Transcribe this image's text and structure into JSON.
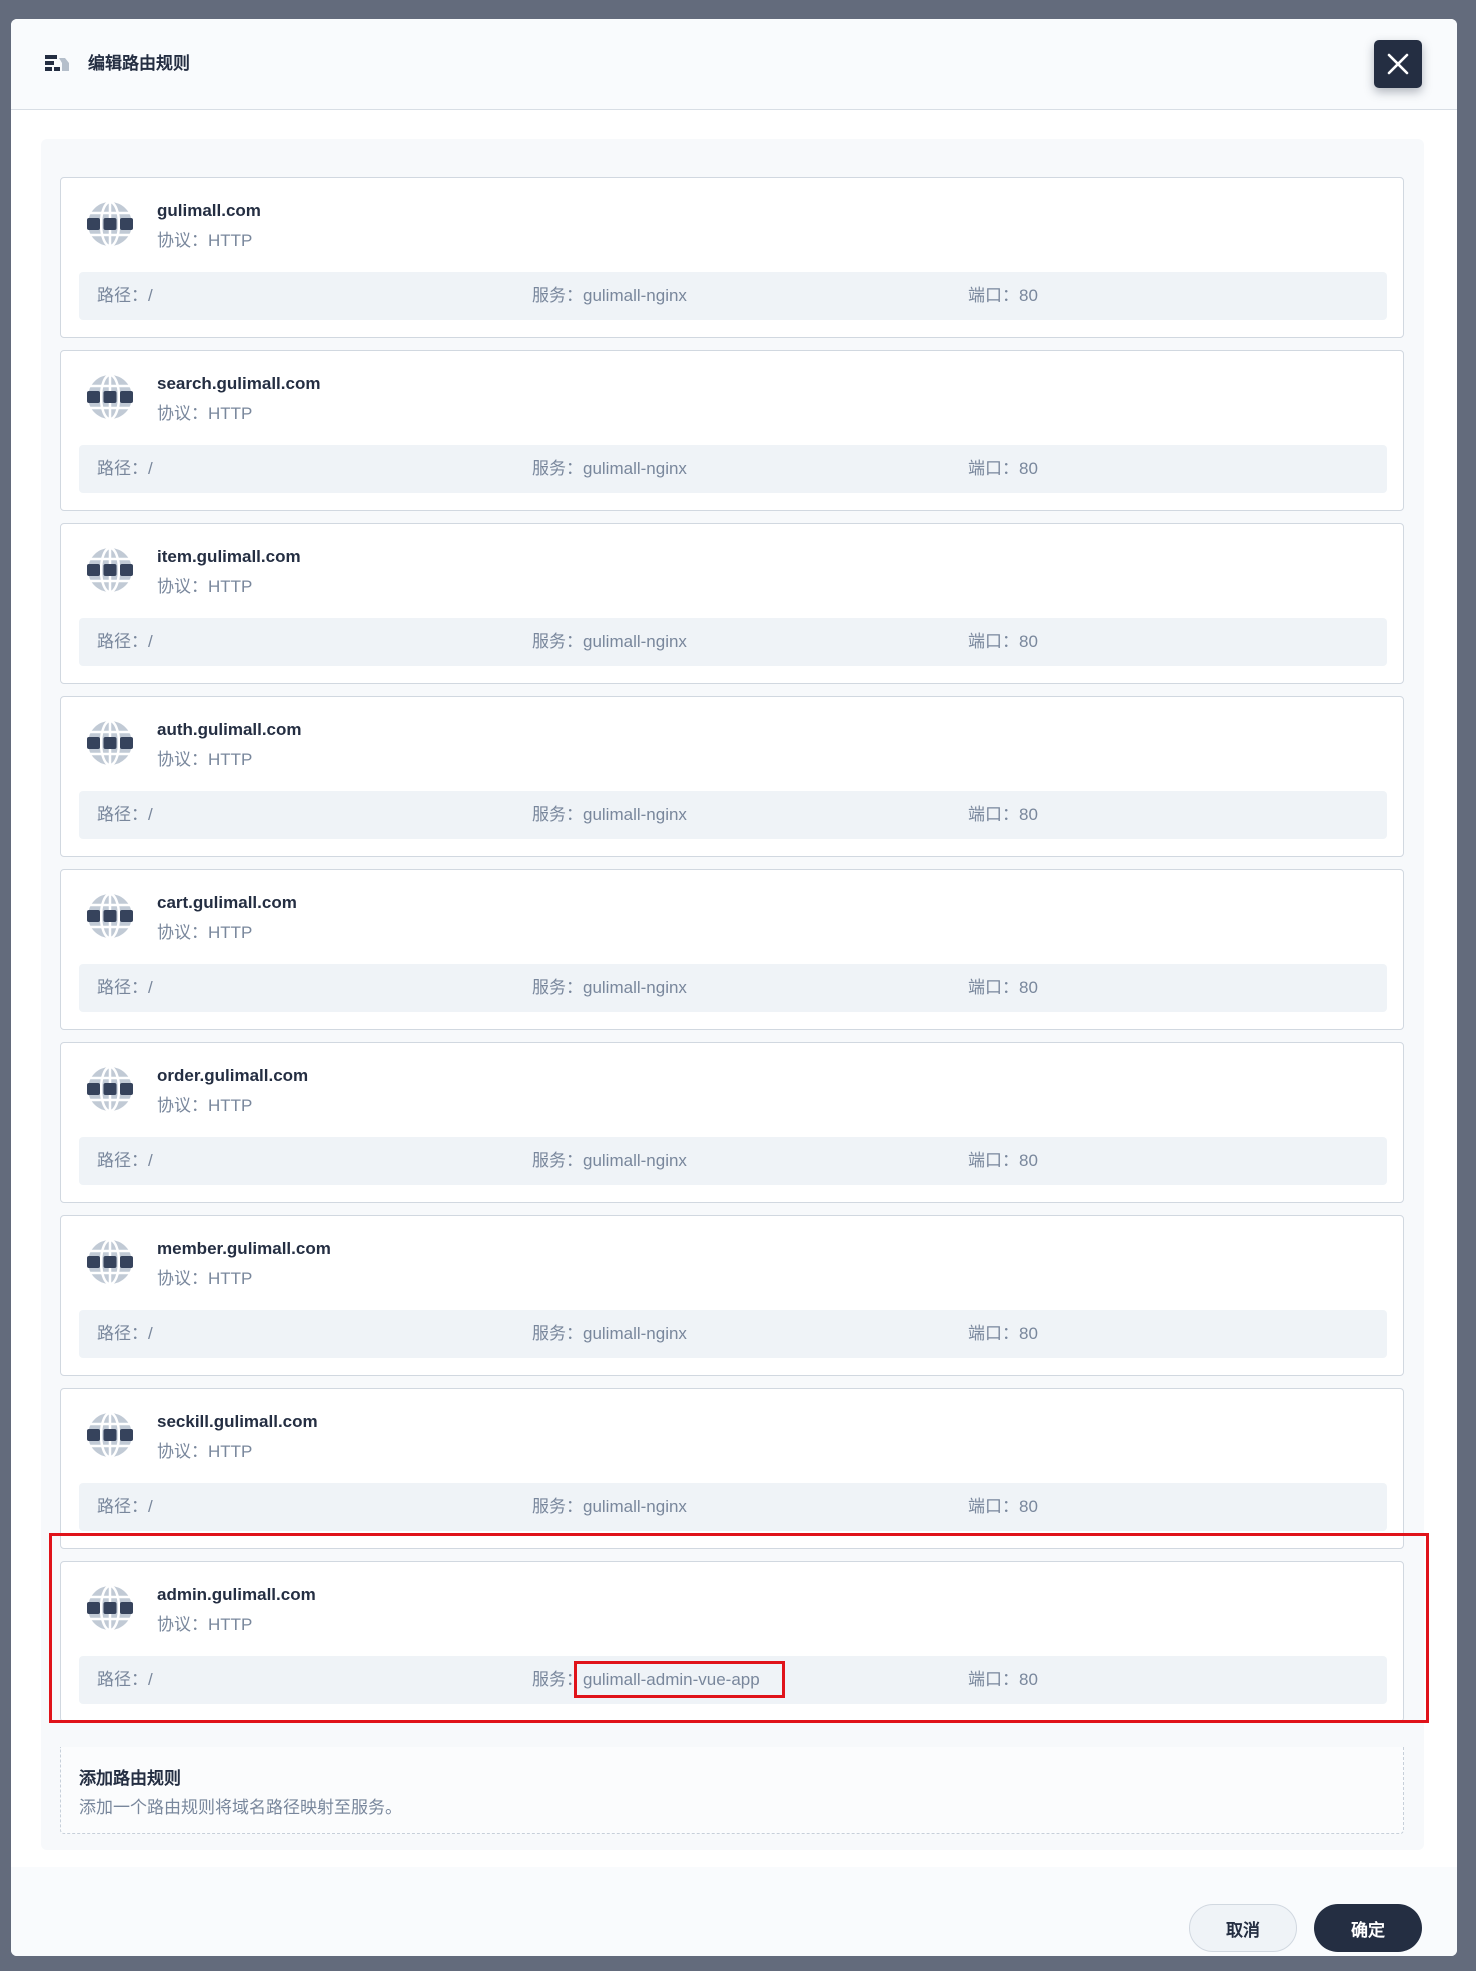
{
  "modal": {
    "title": "编辑路由规则",
    "close_icon": "close-icon",
    "header_icon": "route-rules-icon"
  },
  "rules": [
    {
      "host": "gulimall.com",
      "protocol": "协议：HTTP",
      "path": "路径：/",
      "service_label": "服务：",
      "service": "gulimall-nginx",
      "port": "端口：80"
    },
    {
      "host": "search.gulimall.com",
      "protocol": "协议：HTTP",
      "path": "路径：/",
      "service_label": "服务：",
      "service": "gulimall-nginx",
      "port": "端口：80"
    },
    {
      "host": "item.gulimall.com",
      "protocol": "协议：HTTP",
      "path": "路径：/",
      "service_label": "服务：",
      "service": "gulimall-nginx",
      "port": "端口：80"
    },
    {
      "host": "auth.gulimall.com",
      "protocol": "协议：HTTP",
      "path": "路径：/",
      "service_label": "服务：",
      "service": "gulimall-nginx",
      "port": "端口：80"
    },
    {
      "host": "cart.gulimall.com",
      "protocol": "协议：HTTP",
      "path": "路径：/",
      "service_label": "服务：",
      "service": "gulimall-nginx",
      "port": "端口：80"
    },
    {
      "host": "order.gulimall.com",
      "protocol": "协议：HTTP",
      "path": "路径：/",
      "service_label": "服务：",
      "service": "gulimall-nginx",
      "port": "端口：80"
    },
    {
      "host": "member.gulimall.com",
      "protocol": "协议：HTTP",
      "path": "路径：/",
      "service_label": "服务：",
      "service": "gulimall-nginx",
      "port": "端口：80"
    },
    {
      "host": "seckill.gulimall.com",
      "protocol": "协议：HTTP",
      "path": "路径：/",
      "service_label": "服务：",
      "service": "gulimall-nginx",
      "port": "端口：80"
    },
    {
      "host": "admin.gulimall.com",
      "protocol": "协议：HTTP",
      "path": "路径：/",
      "service_label": "服务：",
      "service": "gulimall-admin-vue-app",
      "port": "端口：80"
    }
  ],
  "add_rule": {
    "title": "添加路由规则",
    "description": "添加一个路由规则将域名路径映射至服务。"
  },
  "footer": {
    "cancel_label": "取消",
    "confirm_label": "确定"
  },
  "colors": {
    "primary": "#242e42",
    "muted": "#79879c",
    "highlight": "#e0131a",
    "backdrop": "#636b7c"
  }
}
